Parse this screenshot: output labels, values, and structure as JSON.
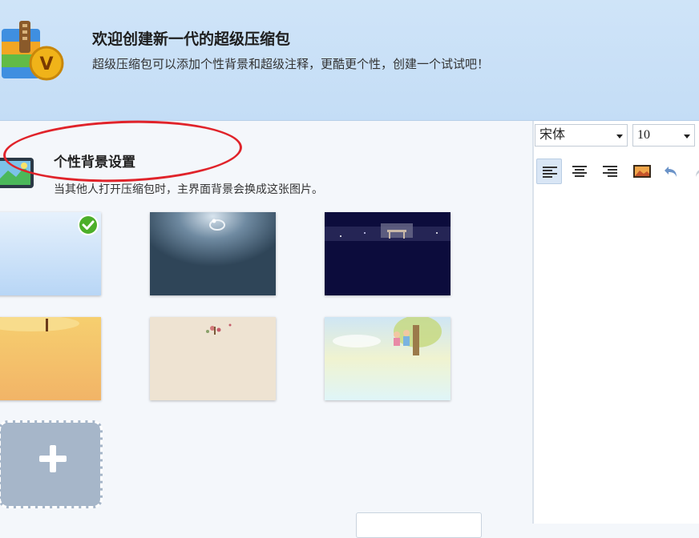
{
  "header": {
    "title": "欢迎创建新一代的超级压缩包",
    "subtitle": "超级压缩包可以添加个性背景和超级注释，更酷更个性，创建一个试试吧！",
    "logo_icon": "super-archive-v-logo-icon"
  },
  "background_section": {
    "title": "个性背景设置",
    "description": "当其他人打开压缩包时，主界面背景会换成这张图片。",
    "icon": "landscape-picture-icon",
    "selected_index": 0,
    "backgrounds": [
      {
        "id": "light-blue",
        "selected": true
      },
      {
        "id": "dark-slate-ring",
        "selected": false
      },
      {
        "id": "night-navy-bench",
        "selected": false
      },
      {
        "id": "golden-orange",
        "selected": false
      },
      {
        "id": "beige-flowers",
        "selected": false
      },
      {
        "id": "pastel-cartoon",
        "selected": false
      }
    ],
    "add_icon": "plus-icon"
  },
  "editor": {
    "font_family": "宋体",
    "font_size": "10",
    "toolbar_icons": [
      "align-left-icon",
      "align-center-icon",
      "align-right-icon",
      "insert-image-icon",
      "undo-icon",
      "redo-icon"
    ]
  },
  "colors": {
    "header_bg": "#c6dff7",
    "annotation_red": "#e0232a",
    "check_green": "#4caf2a",
    "accent_blue": "#2d6fc4"
  }
}
